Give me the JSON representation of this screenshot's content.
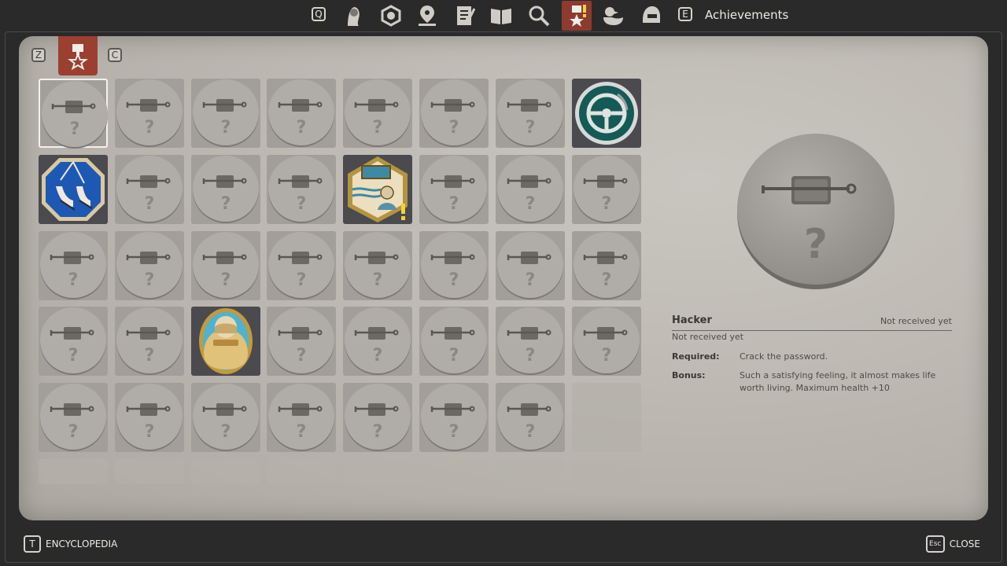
{
  "nav": {
    "left_key": "Q",
    "right_key": "E",
    "title": "Achievements",
    "icons": [
      "character-portrait-icon",
      "thought-cabinet-icon",
      "map-pin-icon",
      "journal-icon",
      "encyclopedia-book-icon",
      "inspect-magnifier-icon",
      "achievements-medal-icon",
      "rubber-duck-icon",
      "helmet-icon"
    ],
    "active_index": 6
  },
  "subnav": {
    "left_key": "Z",
    "right_key": "C"
  },
  "grid": {
    "rows": [
      [
        "selected",
        "locked",
        "locked",
        "locked",
        "locked",
        "locked",
        "locked",
        "steering-wheel"
      ],
      [
        "sneakers",
        "locked",
        "locked",
        "locked",
        "window-portrait-new",
        "locked",
        "locked",
        "locked"
      ],
      [
        "locked",
        "locked",
        "locked",
        "locked",
        "locked",
        "locked",
        "locked",
        "locked"
      ],
      [
        "locked",
        "locked",
        "covered-eyes",
        "locked",
        "locked",
        "locked",
        "locked",
        "locked"
      ],
      [
        "locked",
        "locked",
        "locked",
        "locked",
        "locked",
        "locked",
        "locked",
        "empty"
      ]
    ]
  },
  "detail": {
    "title": "Hacker",
    "status_right": "Not received yet",
    "status": "Not received yet",
    "required_label": "Required:",
    "required_value": "Crack the password.",
    "bonus_label": "Bonus:",
    "bonus_value": "Such a satisfying feeling, it almost makes life worth living. Maximum health +10"
  },
  "footer": {
    "encyclopedia_key": "T",
    "encyclopedia_label": "ENCYCLOPEDIA",
    "close_key": "Esc",
    "close_label": "CLOSE"
  }
}
